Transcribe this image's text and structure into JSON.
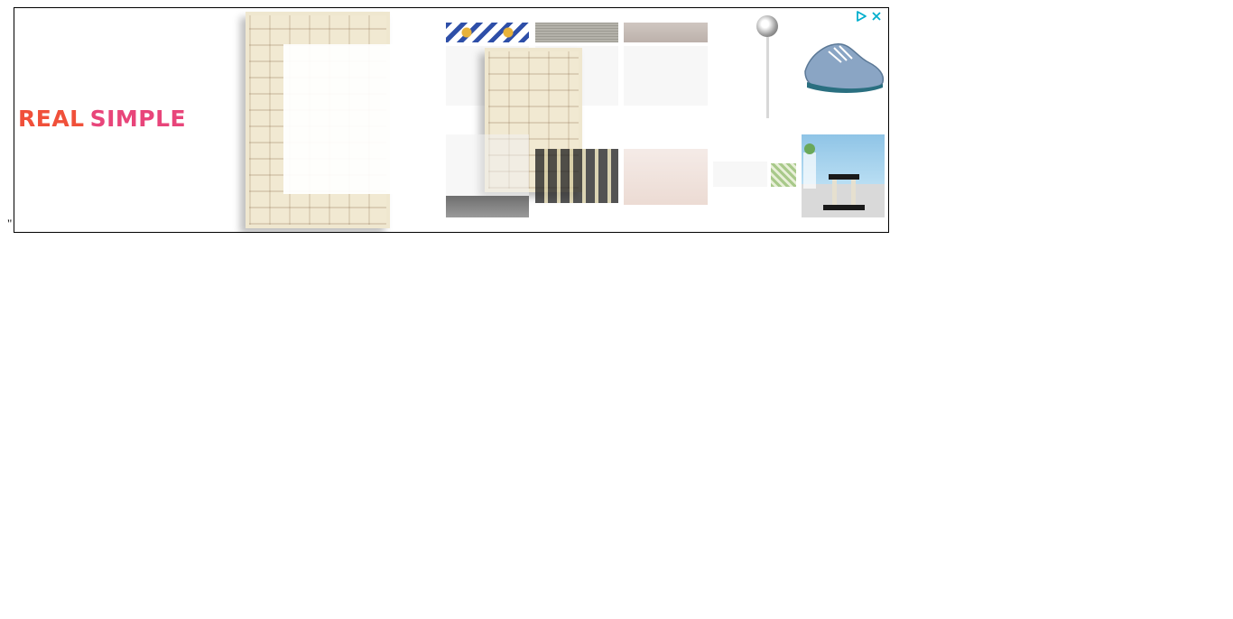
{
  "page": {
    "stray_text": "\""
  },
  "ad": {
    "brand": {
      "word1": "REAL",
      "word2": "SIMPLE"
    },
    "icons": {
      "adchoices": "adchoices-play-icon",
      "close": "close-icon"
    },
    "colors": {
      "brand_red": "#f0503a",
      "brand_pink": "#e8457a",
      "adchoices_teal": "#00aecd"
    }
  }
}
